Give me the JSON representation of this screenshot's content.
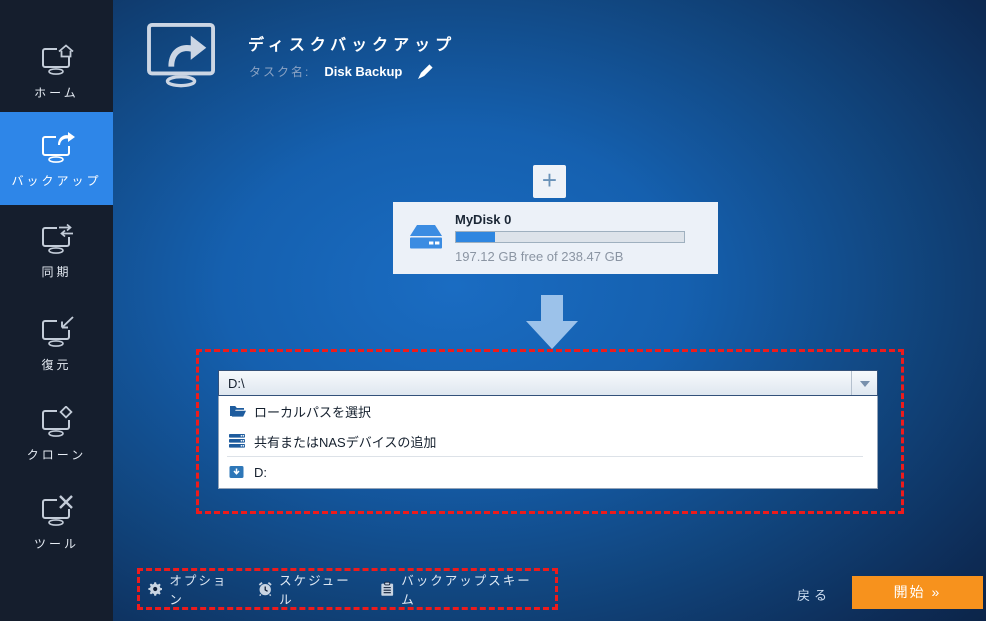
{
  "sidebar": {
    "items": [
      {
        "label": "ホーム",
        "active": false
      },
      {
        "label": "バックアップ",
        "active": true
      },
      {
        "label": "同期",
        "active": false
      },
      {
        "label": "復元",
        "active": false
      },
      {
        "label": "クローン",
        "active": false
      },
      {
        "label": "ツール",
        "active": false
      }
    ]
  },
  "header": {
    "title": "ディスクバックアップ",
    "task_label": "タスク名:",
    "task_name": "Disk Backup"
  },
  "source": {
    "add_button_label": "+",
    "disk": {
      "name": "MyDisk 0",
      "free_text": "197.12 GB free of 238.47 GB",
      "used_percent": 17.3
    }
  },
  "destination": {
    "selected_path": "D:\\",
    "options": [
      {
        "icon": "folder-open-icon",
        "label": "ローカルパスを選択"
      },
      {
        "icon": "nas-server-icon",
        "label": "共有またはNASデバイスの追加"
      },
      {
        "icon": "drive-icon",
        "label": "D:"
      }
    ]
  },
  "footer": {
    "options": [
      {
        "icon": "gear-icon",
        "label": "オプション"
      },
      {
        "icon": "clock-icon",
        "label": "スケジュール"
      },
      {
        "icon": "scheme-icon",
        "label": "バックアップスキーム"
      }
    ],
    "back_label": "戻る",
    "start_label": "開始 »"
  },
  "colors": {
    "accent_blue": "#2e86e8",
    "highlight_orange": "#f7921d",
    "attention_red": "#ee1b1b"
  }
}
